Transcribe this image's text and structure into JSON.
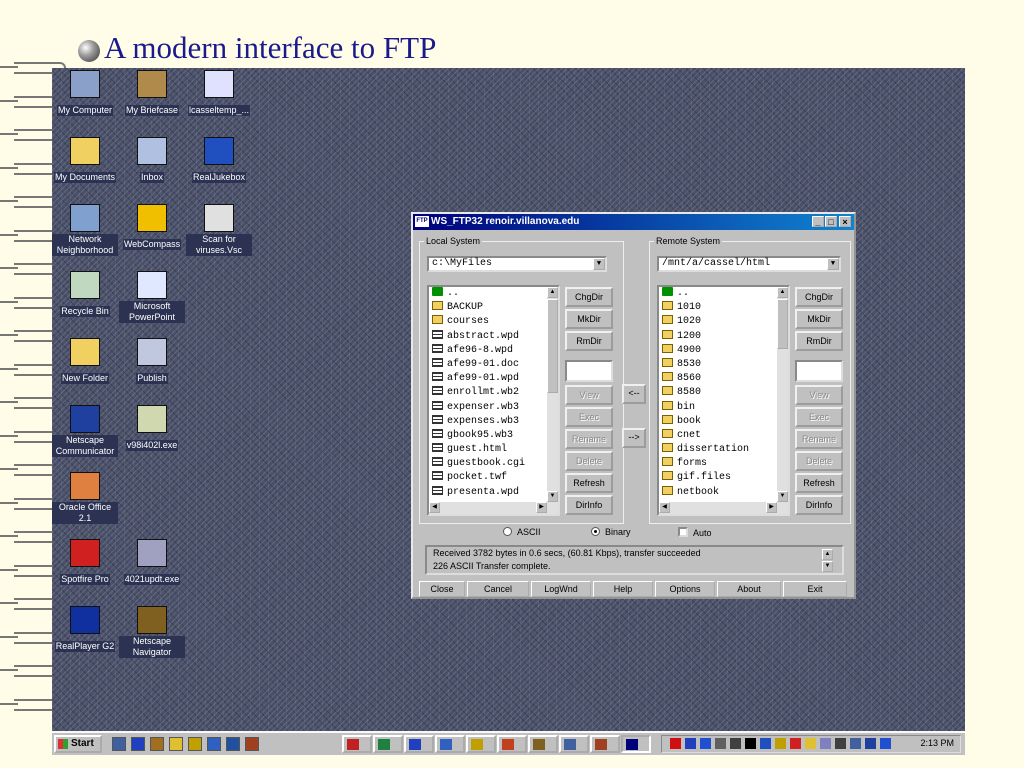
{
  "slide": {
    "title": "A modern interface to FTP"
  },
  "desktop_icons": [
    {
      "name": "desk-icon-my-computer",
      "label": "My Computer",
      "icon": "computer-icon",
      "color": "#8aa0c8"
    },
    {
      "name": "desk-icon-my-briefcase",
      "label": "My Briefcase",
      "icon": "briefcase-icon",
      "color": "#b08a4a"
    },
    {
      "name": "desk-icon-lcasseltemp",
      "label": "lcasseltemp_...",
      "icon": "document-icon",
      "color": "#e0e0ff"
    },
    {
      "name": "desk-icon-my-documents",
      "label": "My Documents",
      "icon": "folder-icon",
      "color": "#f0d060"
    },
    {
      "name": "desk-icon-inbox",
      "label": "Inbox",
      "icon": "inbox-icon",
      "color": "#b0c0e0"
    },
    {
      "name": "desk-icon-realjukebox",
      "label": "RealJukebox",
      "icon": "realjukebox-icon",
      "color": "#2050c0"
    },
    {
      "name": "desk-icon-network-neighborhood",
      "label": "Network Neighborhood",
      "icon": "network-icon",
      "color": "#80a0d0"
    },
    {
      "name": "desk-icon-webcompass",
      "label": "WebCompass",
      "icon": "webcompass-icon",
      "color": "#f0c000"
    },
    {
      "name": "desk-icon-scan-for-viruses",
      "label": "Scan for viruses.Vsc",
      "icon": "scanner-icon",
      "color": "#e0e0e0"
    },
    {
      "name": "desk-icon-recycle-bin",
      "label": "Recycle Bin",
      "icon": "recycle-bin-icon",
      "color": "#c0d8c0"
    },
    {
      "name": "desk-icon-powerpoint",
      "label": "Microsoft PowerPoint",
      "icon": "powerpoint-icon",
      "color": "#e0e8ff"
    },
    {
      "name": "desk-icon-new-folder",
      "label": "New Folder",
      "icon": "folder-icon",
      "color": "#f0d060"
    },
    {
      "name": "desk-icon-publish",
      "label": "Publish",
      "icon": "publish-icon",
      "color": "#c0c8e0"
    },
    {
      "name": "desk-icon-netscape-communicator",
      "label": "Netscape Communicator",
      "icon": "netscape-icon",
      "color": "#2040a0"
    },
    {
      "name": "desk-icon-v98i402l",
      "label": "v98i402l.exe",
      "icon": "setup-icon",
      "color": "#d0d8b0"
    },
    {
      "name": "desk-icon-oracle-office",
      "label": "Oracle Office 2.1",
      "icon": "oracle-office-icon",
      "color": "#e08040"
    },
    {
      "name": "desk-icon-spotfire-pro",
      "label": "Spotfire Pro",
      "icon": "spotfire-icon",
      "color": "#d02020"
    },
    {
      "name": "desk-icon-4021updt",
      "label": "4021updt.exe",
      "icon": "installer-icon",
      "color": "#a0a0c0"
    },
    {
      "name": "desk-icon-realplayer",
      "label": "RealPlayer G2",
      "icon": "realplayer-icon",
      "color": "#1030a0"
    },
    {
      "name": "desk-icon-netscape-navigator",
      "label": "Netscape Navigator",
      "icon": "ship-wheel-icon",
      "color": "#806020"
    }
  ],
  "window": {
    "title": "WS_FTP32 renoir.villanova.edu",
    "app_icon_text": "FTP",
    "min_label": "_",
    "max_label": "□",
    "close_label": "×",
    "local": {
      "legend": "Local System",
      "path": "c:\\MyFiles",
      "files": [
        {
          "name": "..",
          "type": "up"
        },
        {
          "name": "BACKUP",
          "type": "folder"
        },
        {
          "name": "courses",
          "type": "folder"
        },
        {
          "name": "abstract.wpd",
          "type": "file"
        },
        {
          "name": "afe96-8.wpd",
          "type": "file"
        },
        {
          "name": "afe99-01.doc",
          "type": "file"
        },
        {
          "name": "afe99-01.wpd",
          "type": "file"
        },
        {
          "name": "enrollmt.wb2",
          "type": "file"
        },
        {
          "name": "expenser.wb3",
          "type": "file"
        },
        {
          "name": "expenses.wb3",
          "type": "file"
        },
        {
          "name": "gbook95.wb3",
          "type": "file"
        },
        {
          "name": "guest.html",
          "type": "file"
        },
        {
          "name": "guestbook.cgi",
          "type": "file"
        },
        {
          "name": "pocket.twf",
          "type": "file"
        },
        {
          "name": "presenta.wpd",
          "type": "file"
        }
      ]
    },
    "remote": {
      "legend": "Remote System",
      "path": "/mnt/a/cassel/html",
      "files": [
        {
          "name": "..",
          "type": "up"
        },
        {
          "name": "1010",
          "type": "folder"
        },
        {
          "name": "1020",
          "type": "folder"
        },
        {
          "name": "1200",
          "type": "folder"
        },
        {
          "name": "4900",
          "type": "folder"
        },
        {
          "name": "8530",
          "type": "folder"
        },
        {
          "name": "8560",
          "type": "folder"
        },
        {
          "name": "8580",
          "type": "folder"
        },
        {
          "name": "bin",
          "type": "folder"
        },
        {
          "name": "book",
          "type": "folder"
        },
        {
          "name": "cnet",
          "type": "folder"
        },
        {
          "name": "dissertation",
          "type": "folder"
        },
        {
          "name": "forms",
          "type": "folder"
        },
        {
          "name": "gif.files",
          "type": "folder"
        },
        {
          "name": "netbook",
          "type": "folder"
        }
      ]
    },
    "side_buttons": {
      "chgdir": "ChgDir",
      "mkdir": "MkDir",
      "rmdir": "RmDir",
      "view": "View",
      "exec": "Exec",
      "rename": "Rename",
      "delete": "Delete",
      "refresh": "Refresh",
      "dirinfo": "DirInfo"
    },
    "transfer": {
      "to_local": "<--",
      "to_remote": "-->"
    },
    "modes": {
      "ascii": "ASCII",
      "binary": "Binary",
      "auto": "Auto",
      "selected": "binary"
    },
    "status_lines": [
      "Received 3782 bytes in 0.6 secs, (60.81 Kbps), transfer succeeded",
      "226 ASCII Transfer complete."
    ],
    "bottom_buttons": {
      "close": "Close",
      "cancel": "Cancel",
      "logwnd": "LogWnd",
      "help": "Help",
      "options": "Options",
      "about": "About",
      "exit": "Exit"
    }
  },
  "taskbar": {
    "start_label": "Start",
    "clock": "2:13 PM",
    "quick_launch": [
      {
        "name": "quick-launch-desktop-icon",
        "color": "#4060a0"
      },
      {
        "name": "quick-launch-wordperfect-icon",
        "color": "#2040c0"
      },
      {
        "name": "quick-launch-ship-wheel-icon",
        "color": "#a07020"
      },
      {
        "name": "quick-launch-pen-icon",
        "color": "#e0c030"
      },
      {
        "name": "quick-launch-search-icon",
        "color": "#c0a000"
      },
      {
        "name": "quick-launch-monitor-icon",
        "color": "#3060c0"
      },
      {
        "name": "quick-launch-compass-icon",
        "color": "#2050a0"
      },
      {
        "name": "quick-launch-network-icon",
        "color": "#a04020"
      }
    ],
    "tasks": [
      {
        "name": "task-acrobat-icon",
        "color": "#c02020"
      },
      {
        "name": "task-spreadsheet-icon",
        "color": "#208040"
      },
      {
        "name": "task-wordperfect-icon",
        "color": "#2040c0"
      },
      {
        "name": "task-explorer-icon",
        "color": "#3060c0"
      },
      {
        "name": "task-search-icon",
        "color": "#c0a000"
      },
      {
        "name": "task-powerpoint-icon",
        "color": "#c04020"
      },
      {
        "name": "task-ship-wheel-icon",
        "color": "#806020"
      },
      {
        "name": "task-document-icon",
        "color": "#4060a0"
      },
      {
        "name": "task-network-icon",
        "color": "#a04020"
      },
      {
        "name": "task-ftp-icon",
        "color": "#00007b"
      }
    ],
    "tray": [
      {
        "name": "tray-norton-icon",
        "color": "#d01010"
      },
      {
        "name": "tray-shield-icon",
        "color": "#2040c0"
      },
      {
        "name": "tray-monitor-icon",
        "color": "#2050d0"
      },
      {
        "name": "tray-network-icon",
        "color": "#606060"
      },
      {
        "name": "tray-speaker-icon",
        "color": "#404040"
      },
      {
        "name": "tray-disk-icon",
        "color": "#000000"
      },
      {
        "name": "tray-globe-icon",
        "color": "#2050c0"
      },
      {
        "name": "tray-people-icon",
        "color": "#c0a000"
      },
      {
        "name": "tray-tools-icon",
        "color": "#d02020"
      },
      {
        "name": "tray-pen-icon",
        "color": "#e0c030"
      },
      {
        "name": "tray-doc-icon",
        "color": "#8080c0"
      },
      {
        "name": "tray-arrow-icon",
        "color": "#404040"
      },
      {
        "name": "tray-magnifier-icon",
        "color": "#4060a0"
      },
      {
        "name": "tray-card-icon",
        "color": "#2040a0"
      },
      {
        "name": "tray-heart-icon",
        "color": "#2050d0"
      }
    ]
  }
}
